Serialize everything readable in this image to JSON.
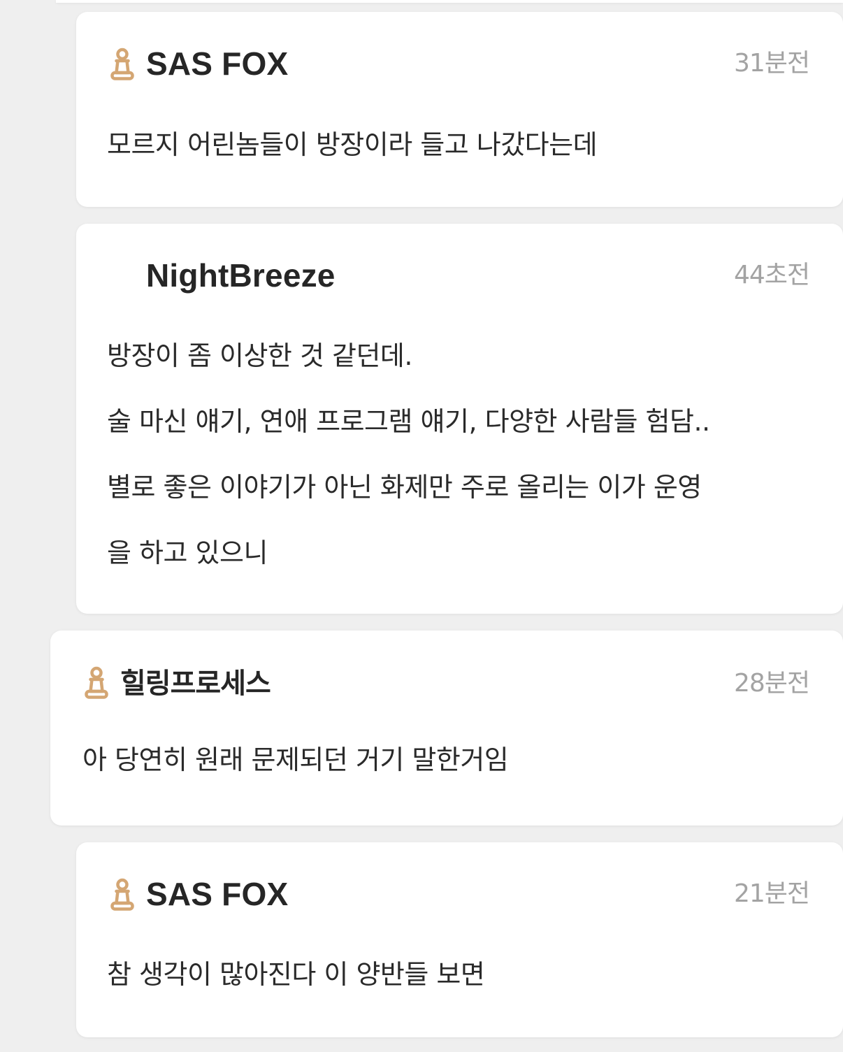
{
  "comments": [
    {
      "username": "SAS FOX",
      "has_badge": true,
      "time": "31분전",
      "lines": [
        "모르지 어린놈들이 방장이라 들고 나갔다는데"
      ]
    },
    {
      "username": "NightBreeze",
      "has_badge": false,
      "time": "44초전",
      "lines": [
        "방장이 좀 이상한 것 같던데.",
        "술 마신 얘기, 연애 프로그램 얘기, 다양한 사람들 험담..",
        "별로 좋은 이야기가 아닌 화제만 주로 올리는 이가 운영",
        "을 하고 있으니"
      ]
    },
    {
      "username": "힐링프로세스",
      "has_badge": true,
      "time": "28분전",
      "lines": [
        "아 당연히 원래 문제되던 거기 말한거임"
      ]
    },
    {
      "username": "SAS FOX",
      "has_badge": true,
      "time": "21분전",
      "lines": [
        "참 생각이 많아진다 이 양반들 보면"
      ]
    }
  ],
  "badge_icon": "pawn-badge-icon",
  "colors": {
    "background": "#efefef",
    "card": "#ffffff",
    "badge": "#d4a673",
    "username": "#262626",
    "timestamp": "#a3a3a3",
    "body_text": "#2a2a2a"
  }
}
